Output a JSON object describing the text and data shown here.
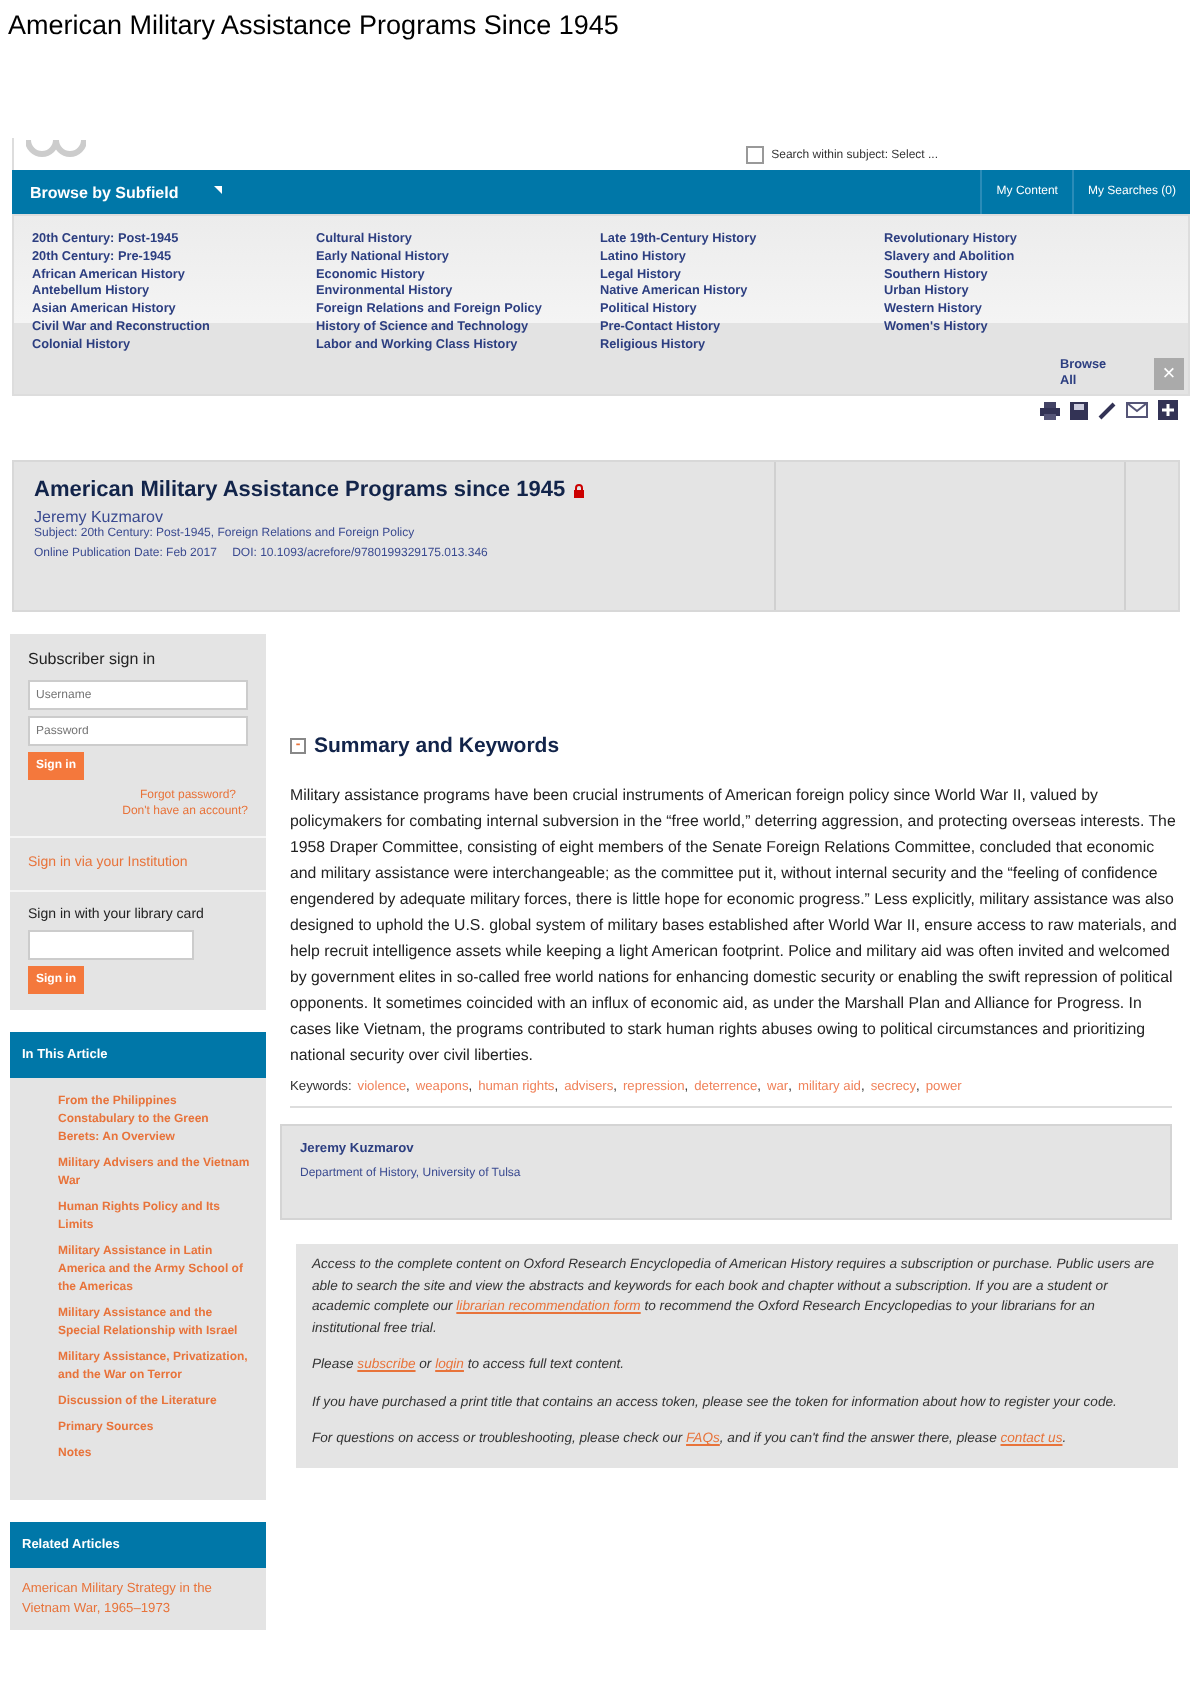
{
  "page_title": "American Military Assistance Programs Since 1945",
  "header": {
    "search_option": {
      "label": "Search within subject: Select ...",
      "checked": false
    }
  },
  "nav": {
    "browse": "Browse by Subfield",
    "links": [
      "My Content",
      "My Searches (0)"
    ]
  },
  "subfields": [
    [
      "20th Century: Post-1945",
      "20th Century: Pre-1945",
      "African American History",
      "Antebellum History",
      "Asian American History",
      "Civil War and Reconstruction",
      "Colonial History"
    ],
    [
      "Cultural History",
      "Early National History",
      "Economic History",
      "Environmental History",
      "Foreign Relations and Foreign Policy",
      "History of Science and Technology",
      "Labor and Working Class History"
    ],
    [
      "Late 19th-Century History",
      "Latino History",
      "Legal History",
      "Native American History",
      "Political History",
      "Pre-Contact History",
      "Religious History"
    ],
    [
      "Revolutionary History",
      "Slavery and Abolition",
      "Southern History",
      "Urban History",
      "Western History",
      "Women's History"
    ]
  ],
  "browse_all": "Browse All",
  "close": "×",
  "article": {
    "title": "American Military Assistance Programs since 1945",
    "locked": true,
    "author": "Jeremy Kuzmarov",
    "subject_label": "Subject:",
    "subject": "20th Century: Post-1945, Foreign Relations and Foreign Policy",
    "date_label": "Online Publication Date:",
    "date": "Feb 2017",
    "doi_label": "DOI:",
    "doi": "10.1093/acrefore/9780199329175.013.346"
  },
  "signin": {
    "title": "Subscriber sign in",
    "username": {
      "placeholder": "Username"
    },
    "password": {
      "placeholder": "Password"
    },
    "button": "Sign in",
    "forgot": "Forgot password?",
    "no_account": "Don't have an account?",
    "institution": "Sign in via your Institution",
    "library_title": "Sign in with your library card",
    "library_button": "Sign in"
  },
  "in_this_article": {
    "title": "In This Article",
    "items": [
      "From the Philippines Constabulary to the Green Berets: An Overview",
      "Military Advisers and the Vietnam War",
      "Human Rights Policy and Its Limits",
      "Military Assistance in Latin America and the Army School of the Americas",
      "Military Assistance and the Special Relationship with Israel",
      "Military Assistance, Privatization, and the War on Terror",
      "Discussion of the Literature",
      "Primary Sources",
      "Notes"
    ]
  },
  "related": {
    "title": "Related Articles",
    "items": [
      "American Military Strategy in the Vietnam War, 1965–1973"
    ]
  },
  "summary": {
    "toggle": "-",
    "heading": "Summary and Keywords",
    "expanded": true,
    "text": "Military assistance programs have been crucial instruments of American foreign policy since World War II, valued by policymakers for combating internal subversion in the “free world,” deterring aggression, and protecting overseas interests. The 1958 Draper Committee, consisting of eight members of the Senate Foreign Relations Committee, concluded that economic and military assistance were interchangeable; as the committee put it, without internal security and the “feeling of confidence engendered by adequate military forces, there is little hope for economic progress.” Less explicitly, military assistance was also designed to uphold the U.S. global system of military bases established after World War II, ensure access to raw materials, and help recruit intelligence assets while keeping a light American footprint. Police and military aid was often invited and welcomed by government elites in so-called free world nations for enhancing domestic security or enabling the swift repression of political opponents. It sometimes coincided with an influx of economic aid, as under the Marshall Plan and Alliance for Progress. In cases like Vietnam, the programs contributed to stark human rights abuses owing to political circumstances and prioritizing national security over civil liberties.",
    "keywords_label": "Keywords:",
    "separator": ",",
    "keywords": [
      "violence",
      "weapons",
      "human rights",
      "advisers",
      "repression",
      "deterrence",
      "war",
      "military aid",
      "secrecy",
      "power"
    ]
  },
  "author_box": {
    "name": "Jeremy Kuzmarov",
    "affiliation": "Department of History, University of Tulsa"
  },
  "access": [
    [
      {
        "kind": "text",
        "text": "Access to the complete content on Oxford Research Encyclopedia of American History requires a subscription or purchase. Public users are able to search the site and view the abstracts and keywords for each book and chapter without a subscription. If you are a student or academic complete our "
      },
      {
        "kind": "link",
        "text": "librarian recommendation form"
      },
      {
        "kind": "text",
        "text": " to recommend the Oxford Research Encyclopedias to your librarians for an institutional free trial."
      }
    ],
    [
      {
        "kind": "text",
        "text": "Please "
      },
      {
        "kind": "link",
        "text": "subscribe"
      },
      {
        "kind": "text",
        "text": " or "
      },
      {
        "kind": "link",
        "text": "login"
      },
      {
        "kind": "text",
        "text": " to access full text content."
      }
    ],
    [
      {
        "kind": "text",
        "text": "If you have purchased a print title that contains an access token, please see the token for information about how to register your code."
      }
    ],
    [
      {
        "kind": "text",
        "text": "For questions on access or troubleshooting, please check our "
      },
      {
        "kind": "link",
        "text": "FAQs"
      },
      {
        "kind": "text",
        "text": ", and if you can't find the answer there, please "
      },
      {
        "kind": "link",
        "text": "contact us"
      },
      {
        "kind": "text",
        "text": "."
      }
    ]
  ]
}
